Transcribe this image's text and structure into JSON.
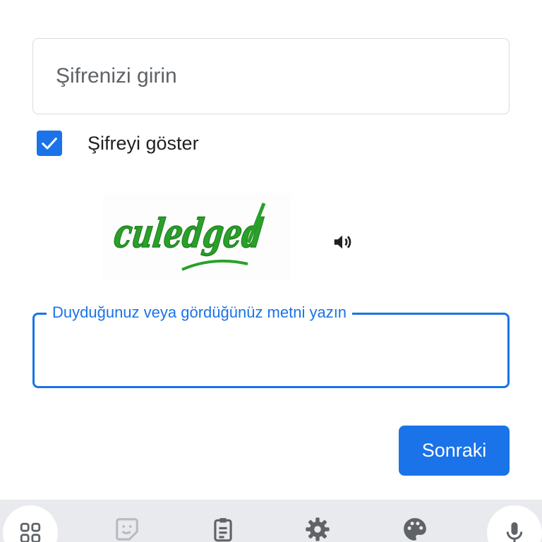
{
  "password": {
    "placeholder": "Şifrenizi girin"
  },
  "show_password": {
    "label": "Şifreyi göster",
    "checked": true
  },
  "captcha": {
    "image_text": "culedged",
    "text_color": "#2aa02a",
    "audio_icon": "speaker-icon"
  },
  "captcha_input": {
    "label": "Duyduğunuz veya gördüğünüz metni yazın",
    "value": ""
  },
  "next_button": {
    "label": "Sonraki"
  },
  "keyboard_toolbar": {
    "icons": [
      "apps-grid-icon",
      "sticker-icon",
      "clipboard-icon",
      "settings-icon",
      "palette-icon",
      "microphone-icon"
    ]
  },
  "colors": {
    "accent": "#1a73e8",
    "toolbar_bg": "#e8eaed",
    "border": "#dadce0"
  }
}
